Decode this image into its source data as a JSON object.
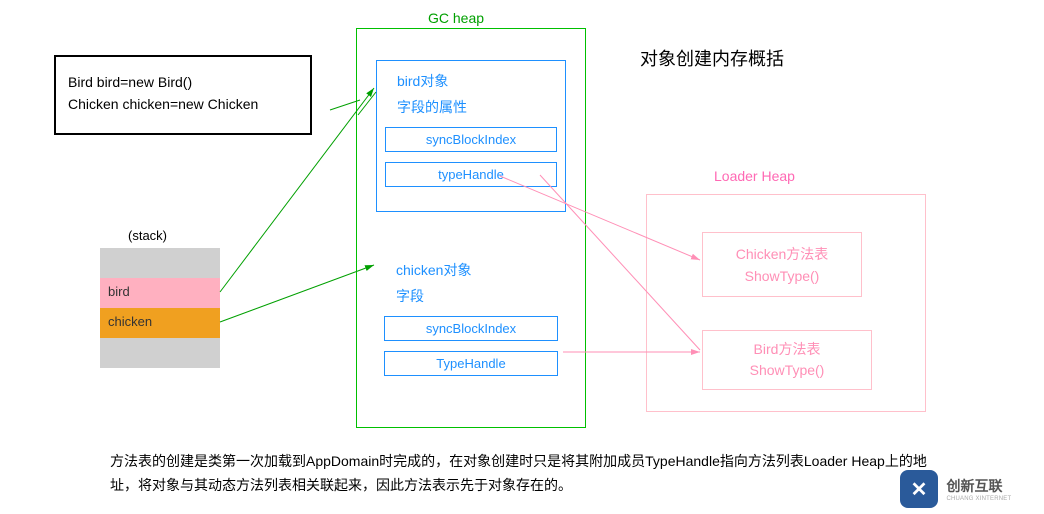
{
  "titles": {
    "gc_heap": "GC heap",
    "main": "对象创建内存概括",
    "loader_heap": "Loader Heap",
    "stack": "(stack)"
  },
  "code": {
    "line1": "Bird bird=new Bird()",
    "line2": "Chicken chicken=new Chicken"
  },
  "bird_obj": {
    "label": "bird对象",
    "fields": "字段的属性",
    "sync": "syncBlockIndex",
    "type": "typeHandle"
  },
  "chicken_obj": {
    "label": "chicken对象",
    "fields": "字段",
    "sync": "syncBlockIndex",
    "type": "TypeHandle"
  },
  "loader": {
    "chicken_table": "Chicken方法表",
    "chicken_show": "ShowType()",
    "bird_table": "Bird方法表",
    "bird_show": "ShowType()"
  },
  "stack": {
    "bird": "bird",
    "chicken": "chicken"
  },
  "footer": "方法表的创建是类第一次加载到AppDomain时完成的，在对象创建时只是将其附加成员TypeHandle指向方法列表Loader Heap上的地址，将对象与其动态方法列表相关联起来，因此方法表示先于对象存在的。",
  "logo": {
    "brand": "创新互联",
    "sub": "CHUANG XINTERNET"
  }
}
